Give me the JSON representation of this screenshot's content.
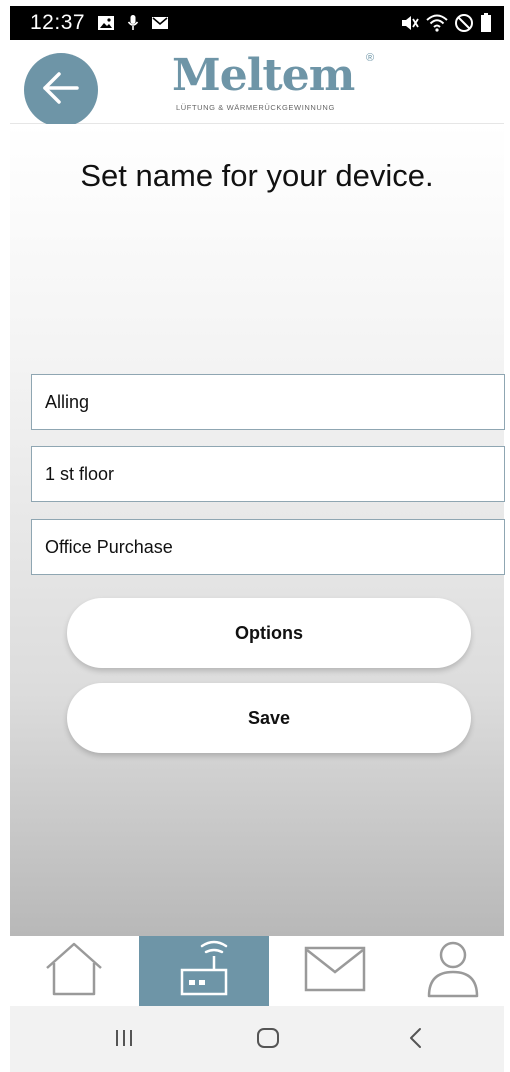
{
  "status_bar": {
    "time": "12:37",
    "icons_left": [
      "image-icon",
      "microphone-icon",
      "mail-icon"
    ],
    "icons_right": [
      "mute-icon",
      "wifi-icon",
      "do-not-disturb-icon",
      "battery-icon"
    ]
  },
  "header": {
    "back_icon": "arrow-left-icon",
    "logo_text": "Meltem",
    "logo_registered": "®",
    "logo_tagline": "LÜFTUNG & WÄRMERÜCKGEWINNUNG"
  },
  "main": {
    "title": "Set name for your device.",
    "fields": [
      {
        "value": "Alling"
      },
      {
        "value": "1 st floor"
      },
      {
        "value": "Office Purchase"
      }
    ],
    "options_label": "Options",
    "save_label": "Save"
  },
  "tab_bar": {
    "tabs": [
      {
        "icon": "home-icon",
        "active": false
      },
      {
        "icon": "router-icon",
        "active": true
      },
      {
        "icon": "mail-icon",
        "active": false
      },
      {
        "icon": "user-icon",
        "active": false
      }
    ]
  },
  "nav_bar": {
    "buttons": [
      "recents-icon",
      "home-icon",
      "back-icon"
    ]
  },
  "colors": {
    "accent": "#6e95a7",
    "status_bar": "#000000",
    "field_border": "#8fa6b2"
  }
}
